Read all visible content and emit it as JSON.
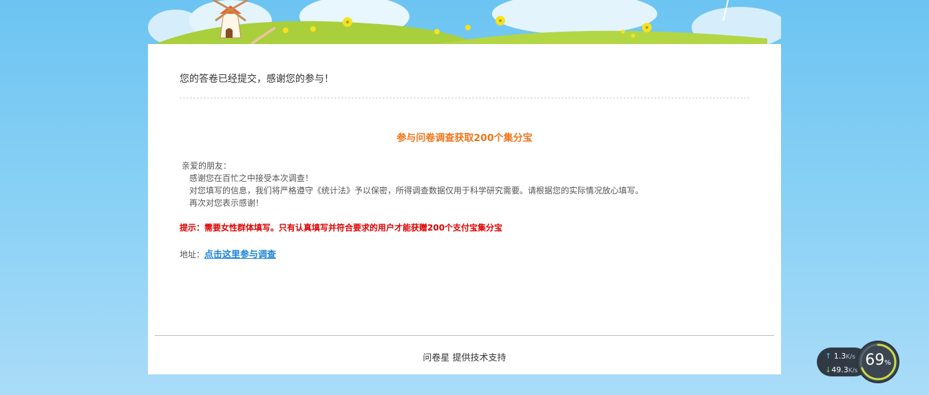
{
  "page": {
    "thanks_message": "您的答卷已经提交，感谢您的参与！",
    "promo_title": "参与问卷调查获取200个集分宝",
    "letter": {
      "greeting": "亲爱的朋友：",
      "line1": "感谢您在百忙之中接受本次调查！",
      "line2": "对您填写的信息，我们将严格遵守《统计法》予以保密，所得调查数据仅用于科学研究需要。请根据您的实际情况放心填写。",
      "line3": "再次对您表示感谢！"
    },
    "tip": "提示：需要女性群体填写。只有认真填写并符合要求的用户才能获赠200个支付宝集分宝",
    "address_label": "地址：",
    "address_link": "点击这里参与调查",
    "footer": "问卷星 提供技术支持"
  },
  "speed_widget": {
    "upload": "1.3",
    "upload_unit": "K/s",
    "download": "49.3",
    "download_unit": "K/s",
    "usage": "69",
    "usage_unit": "%",
    "usage_fraction": 0.69
  },
  "colors": {
    "promo": "#f0751b",
    "tip": "#e00000",
    "link": "#1a83d8"
  }
}
